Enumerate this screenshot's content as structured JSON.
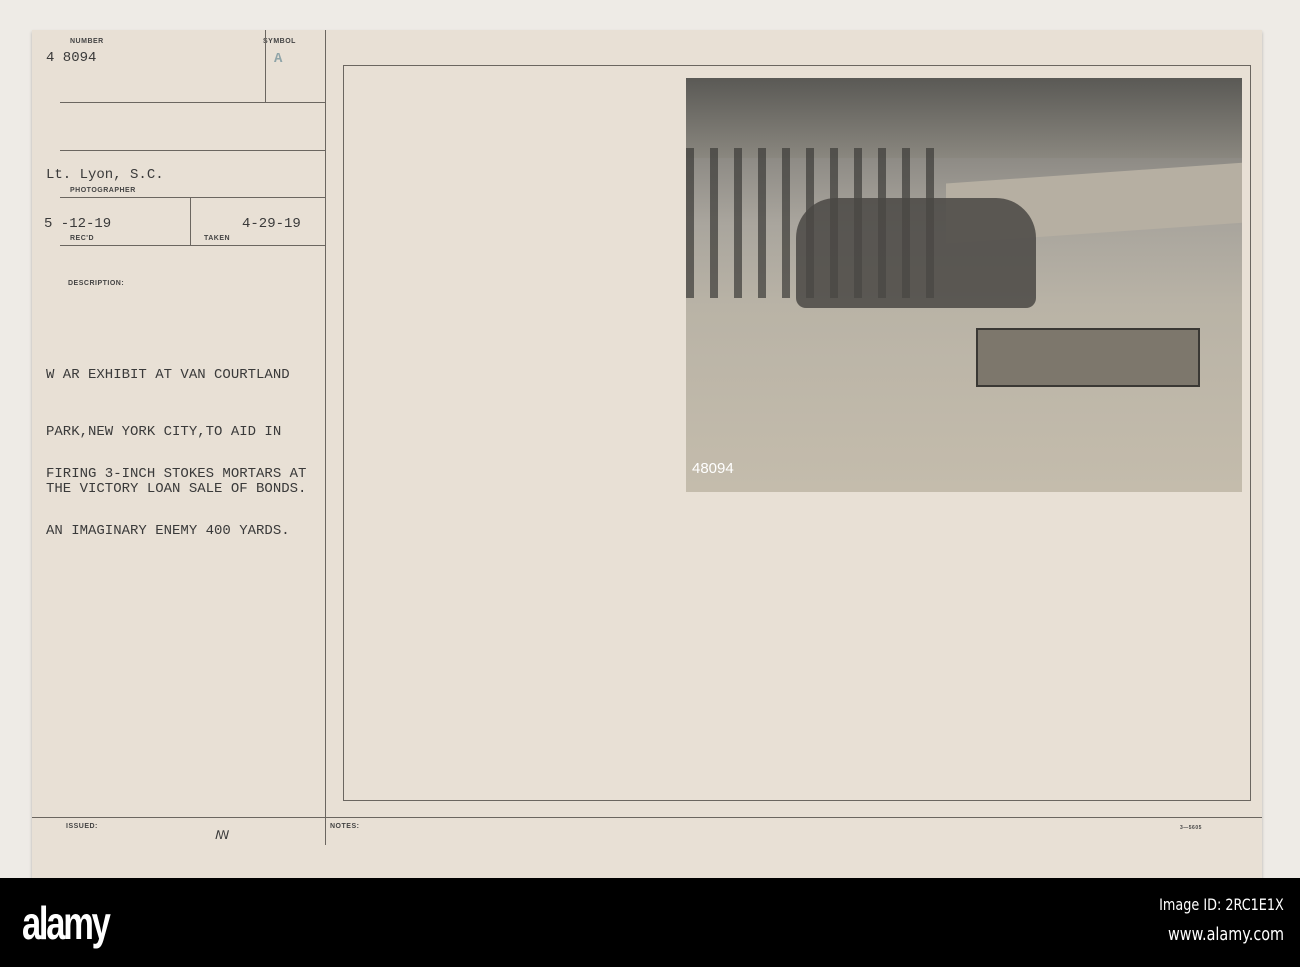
{
  "card": {
    "number_label": "NUMBER",
    "number": "4 8094",
    "symbol_label": "SYMBOL",
    "symbol": "A",
    "photographer": "Lt. Lyon, S.C.",
    "photographer_label": "PHOTOGRAPHER",
    "recd": "5 -12-19",
    "recd_label": "REC'D",
    "taken": "4-29-19",
    "taken_label": "TAKEN",
    "description_label": "DESCRIPTION:",
    "description": [
      "W AR EXHIBIT AT VAN COURTLAND",
      "PARK,NEW YORK CITY,TO AID IN",
      "THE VICTORY LOAN SALE OF BONDS."
    ],
    "caption": [
      "FIRING 3-INCH STOKES MORTARS AT",
      "AN IMAGINARY ENEMY 400 YARDS."
    ],
    "issued_label": "ISSUED:",
    "issued_mark": "ꟿ",
    "notes_label": "NOTES:",
    "form_number": "3—5605",
    "photo_number": "48094"
  },
  "watermark": {
    "logo": "alamy",
    "image_id": "Image ID: 2RC1E1X",
    "url": "www.alamy.com"
  }
}
